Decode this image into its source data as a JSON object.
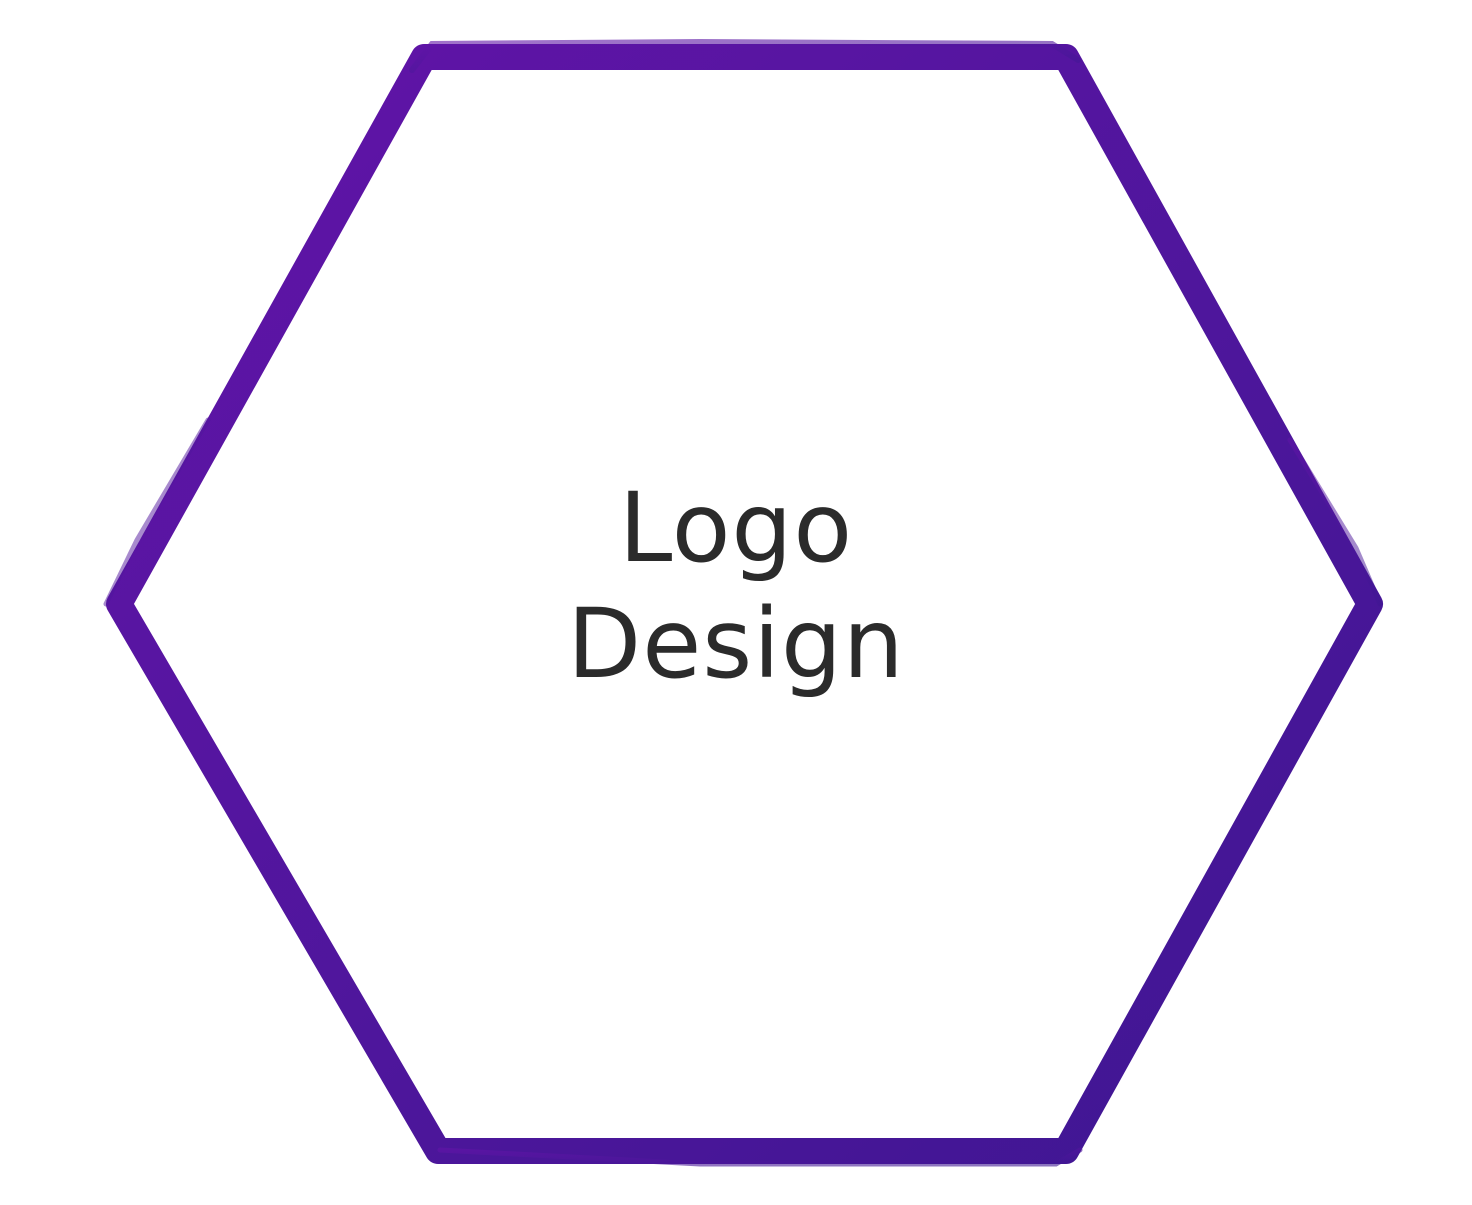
{
  "hexagon": {
    "label_line_1": "Logo",
    "label_line_2": "Design"
  },
  "colors": {
    "stroke_start": "#6214a8",
    "stroke_end": "#3e1792",
    "text": "#2b2b2b",
    "background": "#ffffff"
  }
}
